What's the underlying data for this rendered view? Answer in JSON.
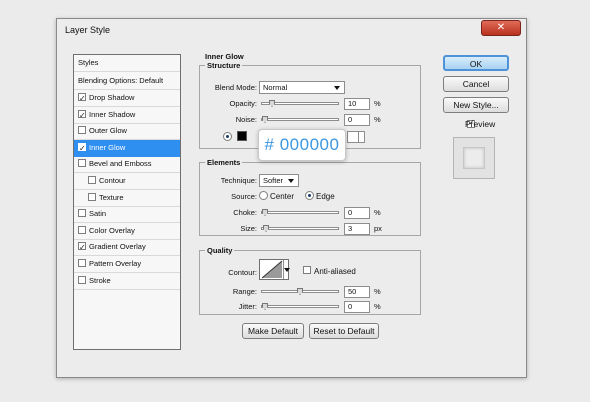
{
  "window": {
    "title": "Layer Style",
    "close_glyph": "✕"
  },
  "styles_list": {
    "header": "Styles",
    "blending_options": "Blending Options: Default",
    "items": [
      {
        "label": "Drop Shadow",
        "checked": true
      },
      {
        "label": "Inner Shadow",
        "checked": true
      },
      {
        "label": "Outer Glow",
        "checked": false
      },
      {
        "label": "Inner Glow",
        "checked": true,
        "selected": true
      },
      {
        "label": "Bevel and Emboss",
        "checked": false
      },
      {
        "label": "Contour",
        "checked": false
      },
      {
        "label": "Texture",
        "checked": false
      },
      {
        "label": "Satin",
        "checked": false
      },
      {
        "label": "Color Overlay",
        "checked": false
      },
      {
        "label": "Gradient Overlay",
        "checked": true
      },
      {
        "label": "Pattern Overlay",
        "checked": false
      },
      {
        "label": "Stroke",
        "checked": false
      }
    ]
  },
  "panel": {
    "title": "Inner Glow",
    "structure": {
      "title": "Structure",
      "blend_mode_label": "Blend Mode:",
      "blend_mode_value": "Normal",
      "opacity_label": "Opacity:",
      "opacity_value": "10",
      "opacity_level": 0.1,
      "noise_label": "Noise:",
      "noise_value": "0",
      "noise_level": 0,
      "color_hex": "#000000",
      "percent": "%"
    },
    "elements": {
      "title": "Elements",
      "technique_label": "Technique:",
      "technique_value": "Softer",
      "source_label": "Source:",
      "source_center": "Center",
      "source_edge": "Edge",
      "choke_label": "Choke:",
      "choke_value": "0",
      "choke_level": 0,
      "size_label": "Size:",
      "size_value": "3",
      "size_unit": "px",
      "percent": "%"
    },
    "quality": {
      "title": "Quality",
      "contour_label": "Contour:",
      "anti_aliased_label": "Anti-aliased",
      "range_label": "Range:",
      "range_value": "50",
      "range_level": 0.5,
      "jitter_label": "Jitter:",
      "jitter_value": "0",
      "jitter_level": 0,
      "percent": "%"
    },
    "make_default": "Make Default",
    "reset_default": "Reset to Default"
  },
  "buttons": {
    "ok": "OK",
    "cancel": "Cancel",
    "new_style": "New Style...",
    "preview": "Preview"
  },
  "tooltip": {
    "text": "# 000000"
  },
  "colors": {
    "accent": "#2f8ff0",
    "tooltip_text": "#3c97e0",
    "glow_color": "#000000"
  }
}
